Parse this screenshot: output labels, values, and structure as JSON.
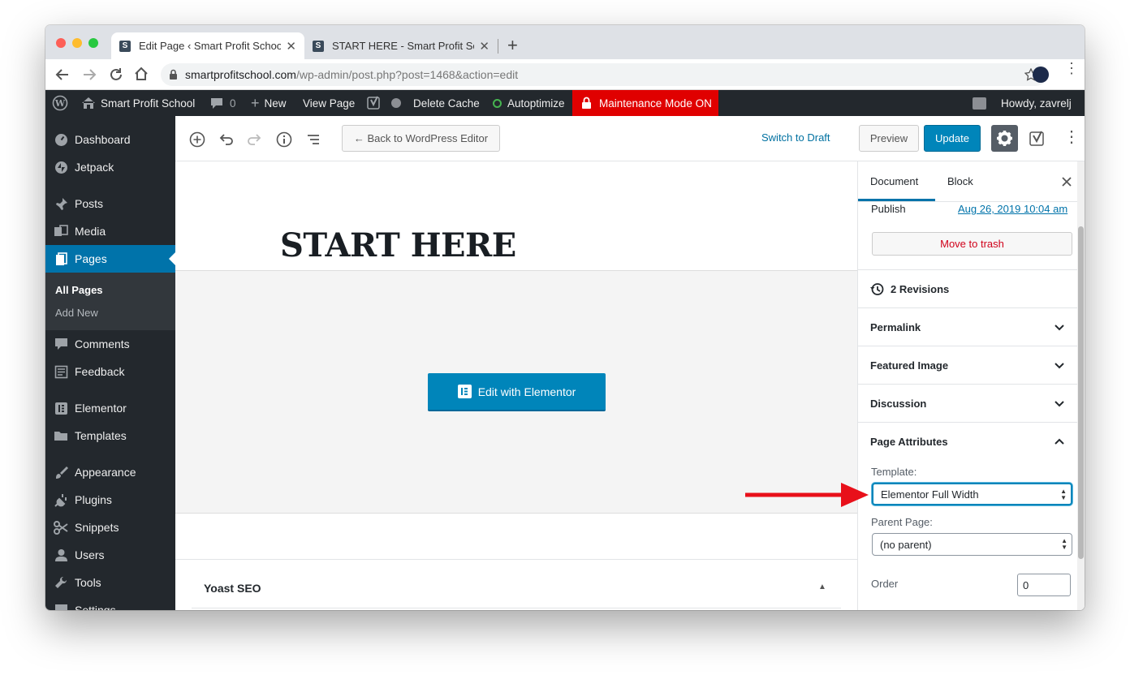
{
  "browser": {
    "tabs": [
      {
        "title": "Edit Page ‹ Smart Profit School",
        "favicon": "S"
      },
      {
        "title": "START HERE - Smart Profit School",
        "favicon": "S"
      }
    ],
    "new_tab": "+",
    "close_tab": "✕",
    "url_host": "smartprofitschool.com",
    "url_path": "/wp-admin/post.php?post=1468&action=edit"
  },
  "adminbar": {
    "site_name": "Smart Profit School",
    "comments_count": "0",
    "new_label": "New",
    "view_page": "View Page",
    "delete_cache": "Delete Cache",
    "autoptimize": "Autoptimize",
    "maintenance": "Maintenance Mode ON",
    "howdy": "Howdy, zavrelj"
  },
  "sidebar": {
    "items": [
      {
        "label": "Dashboard",
        "icon": "dashboard-icon"
      },
      {
        "label": "Jetpack",
        "icon": "jetpack-icon"
      },
      {
        "label": "Posts",
        "icon": "pin-icon"
      },
      {
        "label": "Media",
        "icon": "media-icon"
      },
      {
        "label": "Pages",
        "icon": "pages-icon"
      },
      {
        "label": "Comments",
        "icon": "comment-icon"
      },
      {
        "label": "Feedback",
        "icon": "feedback-icon"
      },
      {
        "label": "Elementor",
        "icon": "elementor-icon"
      },
      {
        "label": "Templates",
        "icon": "folder-icon"
      },
      {
        "label": "Appearance",
        "icon": "brush-icon"
      },
      {
        "label": "Plugins",
        "icon": "plug-icon"
      },
      {
        "label": "Snippets",
        "icon": "scissors-icon"
      },
      {
        "label": "Users",
        "icon": "user-icon"
      },
      {
        "label": "Tools",
        "icon": "wrench-icon"
      },
      {
        "label": "Settings",
        "icon": "settings-icon"
      }
    ],
    "pages_sub": [
      "All Pages",
      "Add New"
    ]
  },
  "editor": {
    "back_button": "← Back to WordPress Editor",
    "switch_draft": "Switch to Draft",
    "preview": "Preview",
    "update": "Update",
    "page_title": "START HERE",
    "elementor_button": "Edit with Elementor",
    "yoast_title": "Yoast SEO"
  },
  "panel": {
    "tab_document": "Document",
    "tab_block": "Block",
    "publish_label": "Publish",
    "publish_date": "Aug 26, 2019 10:04 am",
    "trash": "Move to trash",
    "revisions": "2 Revisions",
    "permalink": "Permalink",
    "featured_image": "Featured Image",
    "discussion": "Discussion",
    "page_attributes": "Page Attributes",
    "template_label": "Template:",
    "template_value": "Elementor Full Width",
    "parent_label": "Parent Page:",
    "parent_value": "(no parent)",
    "order_label": "Order",
    "order_value": "0"
  },
  "colors": {
    "wp_dark": "#23282d",
    "wp_blue": "#0073aa",
    "update_blue": "#0085ba",
    "maintenance_red": "#e00000",
    "link_blue": "#0071a1",
    "arrow_red": "#e8101a"
  }
}
